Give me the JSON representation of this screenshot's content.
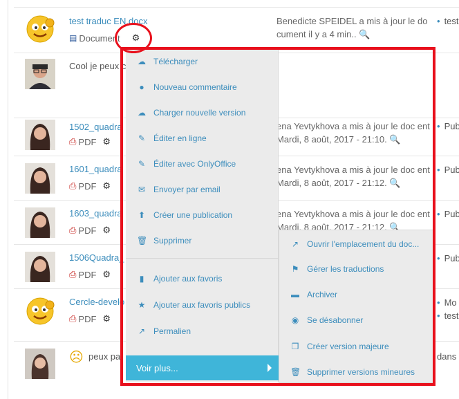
{
  "rows": [
    {
      "title": "test traduc EN.docx",
      "type": "Document",
      "activity": "Benedicte SPEIDEL a mis à jour le do cument il y a 4 min..",
      "side": "test"
    },
    {
      "comment": "Cool je peux c"
    },
    {
      "title": "1502_quadra",
      "type": "PDF",
      "activity": "ena Yevtykhova a mis à jour le doc ent Mardi, 8 août, 2017 - 21:10.",
      "side": "Pub"
    },
    {
      "title": "1601_quadra",
      "type": "PDF",
      "activity": "ena Yevtykhova a mis à jour le doc ent Mardi, 8 août, 2017 - 21:12.",
      "side": "Pub"
    },
    {
      "title": "1603_quadra",
      "type": "PDF",
      "activity": "ena Yevtykhova a mis à jour le doc ent Mardi, 8 août, 2017 - 21:12.",
      "side": "Pub"
    },
    {
      "title": "1506Quadra_",
      "type": "PDF",
      "side": "Pub"
    },
    {
      "title": "Cercle-develo",
      "type": "PDF",
      "side": "Mo",
      "side2": "test"
    },
    {
      "comment": "peux pa",
      "side": "dans"
    }
  ],
  "menu": {
    "items": [
      {
        "label": "Télécharger",
        "icon": "cloud-download-icon",
        "glyph": "☁"
      },
      {
        "label": "Nouveau commentaire",
        "icon": "comment-icon",
        "glyph": "●"
      },
      {
        "label": "Charger nouvelle version",
        "icon": "cloud-upload-icon",
        "glyph": "☁"
      },
      {
        "label": "Éditer en ligne",
        "icon": "edit-icon",
        "glyph": "✎"
      },
      {
        "label": "Éditer avec OnlyOffice",
        "icon": "edit-icon",
        "glyph": "✎"
      },
      {
        "label": "Envoyer par email",
        "icon": "envelope-icon",
        "glyph": "✉"
      },
      {
        "label": "Créer une publication",
        "icon": "arrow-up-icon",
        "glyph": "⬆"
      },
      {
        "label": "Supprimer",
        "icon": "trash-icon",
        "glyph": "🗑"
      },
      {
        "label": "Ajouter aux favoris",
        "icon": "bookmark-icon",
        "glyph": "▮"
      },
      {
        "label": "Ajouter aux favoris publics",
        "icon": "star-icon",
        "glyph": "★"
      },
      {
        "label": "Permalien",
        "icon": "external-link-icon",
        "glyph": "↗"
      }
    ],
    "more_label": "Voir plus..."
  },
  "submenu": {
    "items": [
      {
        "label": "Ouvrir l'emplacement du doc...",
        "icon": "external-link-icon",
        "glyph": "↗"
      },
      {
        "label": "Gérer les traductions",
        "icon": "flag-icon",
        "glyph": "⚑"
      },
      {
        "label": "Archiver",
        "icon": "archive-icon",
        "glyph": "▬"
      },
      {
        "label": "Se désabonner",
        "icon": "rss-icon",
        "glyph": "◉"
      },
      {
        "label": "Créer version majeure",
        "icon": "copy-icon",
        "glyph": "❐"
      },
      {
        "label": "Supprimer versions mineures",
        "icon": "trash-icon",
        "glyph": "🗑"
      }
    ]
  },
  "colors": {
    "link": "#3c8dbc",
    "annotation": "#e8101c",
    "menu_bg": "#ebebeb",
    "more_bg": "#3fb5d9",
    "pdf": "#c9302c"
  }
}
